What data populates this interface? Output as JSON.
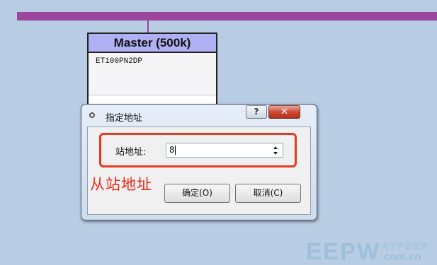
{
  "network": {
    "bus_color": "#9b459e"
  },
  "device": {
    "title": "Master (500k)",
    "model": "ET100PN2DP",
    "title_color": "#b0b0f4"
  },
  "dialog": {
    "title": "指定地址",
    "help_label": "?",
    "close_label": "✕",
    "field_label": "站地址:",
    "field_value": "8",
    "ok_label": "确定(O)",
    "cancel_label": "取消(C)"
  },
  "annotation": {
    "text": "从站地址",
    "color": "#e8291a"
  },
  "watermark": {
    "main": "EEPW",
    "tagline": "电子产品世界",
    "domain": ".com.cn"
  }
}
